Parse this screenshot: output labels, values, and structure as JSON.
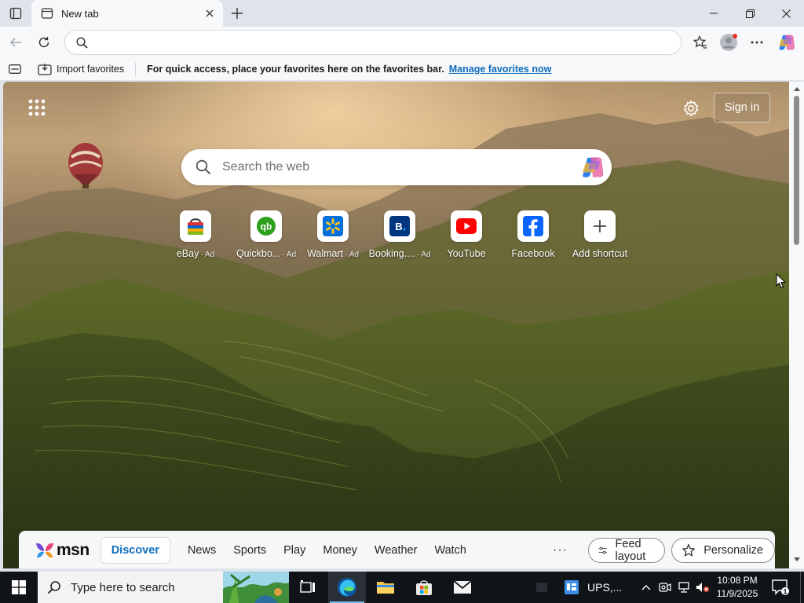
{
  "browser": {
    "tab": {
      "title": "New tab"
    },
    "address_bar": {
      "value": "",
      "placeholder": ""
    }
  },
  "favorites_bar": {
    "import_label": "Import favorites",
    "message": "For quick access, place your favorites here on the favorites bar.",
    "manage_link": "Manage favorites now"
  },
  "newtab": {
    "sign_in": "Sign in",
    "search_placeholder": "Search the web",
    "shortcuts": [
      {
        "label": "eBay",
        "ad": "· Ad"
      },
      {
        "label": "Quickbo...",
        "ad": "· Ad"
      },
      {
        "label": "Walmart",
        "ad": "· Ad"
      },
      {
        "label": "Booking....",
        "ad": "· Ad"
      },
      {
        "label": "YouTube",
        "ad": ""
      },
      {
        "label": "Facebook",
        "ad": ""
      },
      {
        "label": "Add shortcut",
        "ad": ""
      }
    ],
    "feed": {
      "logo": "msn",
      "active_tab": "Discover",
      "tabs": [
        "News",
        "Sports",
        "Play",
        "Money",
        "Weather",
        "Watch"
      ],
      "more": "···",
      "feed_layout": "Feed layout",
      "personalize": "Personalize"
    }
  },
  "taskbar": {
    "search_placeholder": "Type here to search",
    "pinned_app_label": "UPS,...",
    "time": "10:08 PM",
    "date": "11/9/2025",
    "notification_count": "1"
  },
  "colors": {
    "accent": "#0f6cbd",
    "chrome": "#dfe3ea",
    "taskbar": "#101418",
    "youtube_red": "#ff0000",
    "facebook_blue": "#0866ff",
    "walmart_blue": "#0071dc",
    "booking_blue": "#003580",
    "quickbooks_green": "#2ca01c"
  }
}
